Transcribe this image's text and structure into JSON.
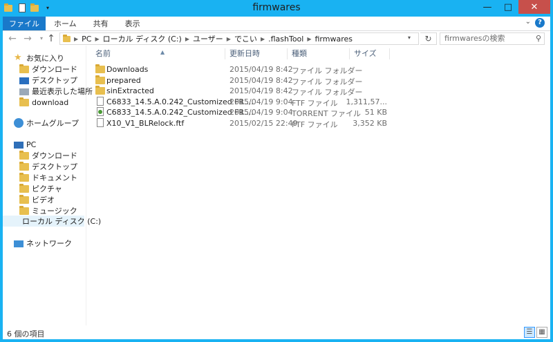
{
  "window": {
    "title": "firmwares"
  },
  "ribbon": {
    "tabs": [
      "ファイル",
      "ホーム",
      "共有",
      "表示"
    ]
  },
  "address": {
    "crumbs": [
      "PC",
      "ローカル ディスク (C:)",
      "ユーザー",
      "でこい",
      ".flashTool",
      "firmwares"
    ]
  },
  "search": {
    "placeholder": "firmwaresの検索"
  },
  "navpane": {
    "favorites_label": "お気に入り",
    "favorites": [
      "ダウンロード",
      "デスクトップ",
      "最近表示した場所",
      "download"
    ],
    "homegroup_label": "ホームグループ",
    "pc_label": "PC",
    "pc_items": [
      "ダウンロード",
      "デスクトップ",
      "ドキュメント",
      "ピクチャ",
      "ビデオ",
      "ミュージック",
      "ローカル ディスク (C:)"
    ],
    "network_label": "ネットワーク"
  },
  "columns": {
    "name": "名前",
    "date": "更新日時",
    "type": "種類",
    "size": "サイズ"
  },
  "files": [
    {
      "icon": "folder-icon",
      "name": "Downloads",
      "date": "2015/04/19 8:42",
      "type": "ファイル フォルダー",
      "size": ""
    },
    {
      "icon": "folder-icon",
      "name": "prepared",
      "date": "2015/04/19 8:42",
      "type": "ファイル フォルダー",
      "size": ""
    },
    {
      "icon": "folder-icon",
      "name": "sinExtracted",
      "date": "2015/04/19 8:42",
      "type": "ファイル フォルダー",
      "size": ""
    },
    {
      "icon": "file-icon",
      "name": "C6833_14.5.A.0.242_Customized FR....",
      "date": "2015/04/19 9:04",
      "type": "FTF ファイル",
      "size": "1,311,57..."
    },
    {
      "icon": "torrent-file-icon",
      "name": "C6833_14.5.A.0.242_Customized FR....",
      "date": "2015/04/19 9:04",
      "type": "TORRENT ファイル",
      "size": "51 KB"
    },
    {
      "icon": "file-icon",
      "name": "X10_V1_BLRelock.ftf",
      "date": "2015/02/15 22:49",
      "type": "FTF ファイル",
      "size": "3,352 KB"
    }
  ],
  "status": {
    "item_count": "6 個の項目"
  }
}
